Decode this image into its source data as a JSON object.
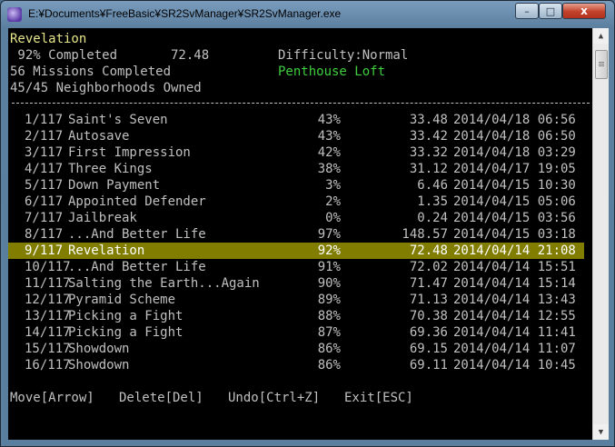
{
  "window": {
    "title": "E:¥Documents¥FreeBasic¥SR2SvManager¥SR2SvManager.exe",
    "minimize_glyph": "–",
    "maximize_glyph": "□",
    "close_glyph": "x"
  },
  "header": {
    "save_name": "Revelation",
    "completion": " 92% Completed       72.48",
    "difficulty": "Difficulty:Normal",
    "missions": "56 Missions Completed",
    "location": "Penthouse Loft",
    "neighborhoods": "45/45 Neighborhoods Owned"
  },
  "saves": [
    {
      "idx": "1/117",
      "name": "Saint's Seven",
      "pct": "43%",
      "time": "33.48",
      "date": "2014/04/18 06:56"
    },
    {
      "idx": "2/117",
      "name": "Autosave",
      "pct": "43%",
      "time": "33.42",
      "date": "2014/04/18 06:50"
    },
    {
      "idx": "3/117",
      "name": "First Impression",
      "pct": "42%",
      "time": "33.32",
      "date": "2014/04/18 03:29"
    },
    {
      "idx": "4/117",
      "name": "Three Kings",
      "pct": "38%",
      "time": "31.12",
      "date": "2014/04/17 19:05"
    },
    {
      "idx": "5/117",
      "name": "Down Payment",
      "pct": "3%",
      "time": "6.46",
      "date": "2014/04/15 10:30"
    },
    {
      "idx": "6/117",
      "name": "Appointed Defender",
      "pct": "2%",
      "time": "1.35",
      "date": "2014/04/15 05:06"
    },
    {
      "idx": "7/117",
      "name": "Jailbreak",
      "pct": "0%",
      "time": "0.24",
      "date": "2014/04/15 03:56"
    },
    {
      "idx": "8/117",
      "name": "...And Better Life",
      "pct": "97%",
      "time": "148.57",
      "date": "2014/04/15 03:18"
    },
    {
      "idx": "9/117",
      "name": "Revelation",
      "pct": "92%",
      "time": "72.48",
      "date": "2014/04/14 21:08"
    },
    {
      "idx": "10/117",
      "name": "...And Better Life",
      "pct": "91%",
      "time": "72.02",
      "date": "2014/04/14 15:51"
    },
    {
      "idx": "11/117",
      "name": "Salting the Earth...Again",
      "pct": "90%",
      "time": "71.47",
      "date": "2014/04/14 15:14"
    },
    {
      "idx": "12/117",
      "name": "Pyramid Scheme",
      "pct": "89%",
      "time": "71.13",
      "date": "2014/04/14 13:43"
    },
    {
      "idx": "13/117",
      "name": "Picking a Fight",
      "pct": "88%",
      "time": "70.38",
      "date": "2014/04/14 12:55"
    },
    {
      "idx": "14/117",
      "name": "Picking a Fight",
      "pct": "87%",
      "time": "69.36",
      "date": "2014/04/14 11:41"
    },
    {
      "idx": "15/117",
      "name": "Showdown",
      "pct": "86%",
      "time": "69.15",
      "date": "2014/04/14 11:07"
    },
    {
      "idx": "16/117",
      "name": "Showdown",
      "pct": "86%",
      "time": "69.11",
      "date": "2014/04/14 10:45"
    }
  ],
  "selected_index": 8,
  "footer": {
    "move": "Move[Arrow]",
    "delete": "Delete[Del]",
    "undo": "Undo[Ctrl+Z]",
    "exit": "Exit[ESC]"
  },
  "colors": {
    "highlight": "#807d00",
    "save_name": "#e6e68a",
    "location": "#3ecf3e"
  },
  "scrollbar": {
    "up_glyph": "▲",
    "down_glyph": "▼"
  }
}
